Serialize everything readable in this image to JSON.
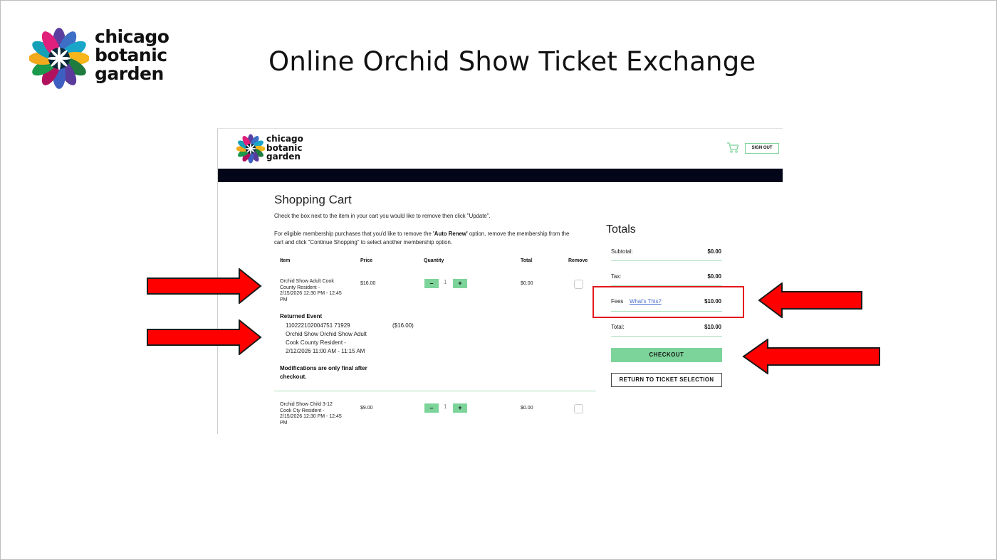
{
  "slide": {
    "title": "Online Orchid Show Ticket Exchange",
    "logo_lines": [
      "chicago",
      "botanic",
      "garden"
    ]
  },
  "site": {
    "logo_lines": [
      "chicago",
      "botanic",
      "garden"
    ],
    "sign_out_label": "SIGN OUT",
    "cart_icon": "shopping-cart-icon"
  },
  "cart": {
    "title": "Shopping Cart",
    "instruction": "Check the box next to the item in your cart you would like to remove then click \"Update\".",
    "membership_note_pre": "For eligible membership purchases that you'd like to remove the ",
    "membership_note_bold": "'Auto Renew'",
    "membership_note_post": " option, remove the membership from the cart and click \"Continue Shopping\" to select another membership option.",
    "columns": [
      "Item",
      "Price",
      "Quantity",
      "Total",
      "Remove"
    ],
    "items": [
      {
        "name_lines": [
          "Orchid Show Adult Cook",
          "County Resident    -",
          "2/15/2026 12:30 PM - 12:45",
          "PM"
        ],
        "price": "$16.00",
        "quantity": "1",
        "total": "$0.00",
        "minus": "–",
        "plus": "+"
      },
      {
        "name_lines": [
          "Orchid Show Child 3-12",
          "Cook Cty Resident    -",
          "2/15/2026 12:30 PM - 12:45",
          "PM"
        ],
        "price": "$9.00",
        "quantity": "1",
        "total": "$0.00",
        "minus": "–",
        "plus": "+"
      }
    ],
    "returned_event": {
      "title": "Returned Event",
      "lines": [
        "110222102004751 71929",
        "Orchid Show Orchid Show Adult",
        "Cook County Resident    -",
        "2/12/2026 11:00 AM - 11:15 AM"
      ],
      "price": "($16.00)"
    },
    "modifications_note": "Modifications are only final after checkout."
  },
  "totals": {
    "title": "Totals",
    "subtotal_label": "Subtotal:",
    "subtotal": "$0.00",
    "tax_label": "Tax:",
    "tax": "$0.00",
    "fees_label": "Fees",
    "fees_link": "What's This?",
    "fees": "$10.00",
    "total_label": "Total:",
    "total": "$10.00",
    "checkout_label": "CHECKOUT",
    "return_label": "RETURN TO TICKET SELECTION"
  },
  "colors": {
    "accent_green": "#7dd49a",
    "navbar": "#020618",
    "highlight_red": "#e3161d",
    "arrow_red": "#ff0000"
  }
}
